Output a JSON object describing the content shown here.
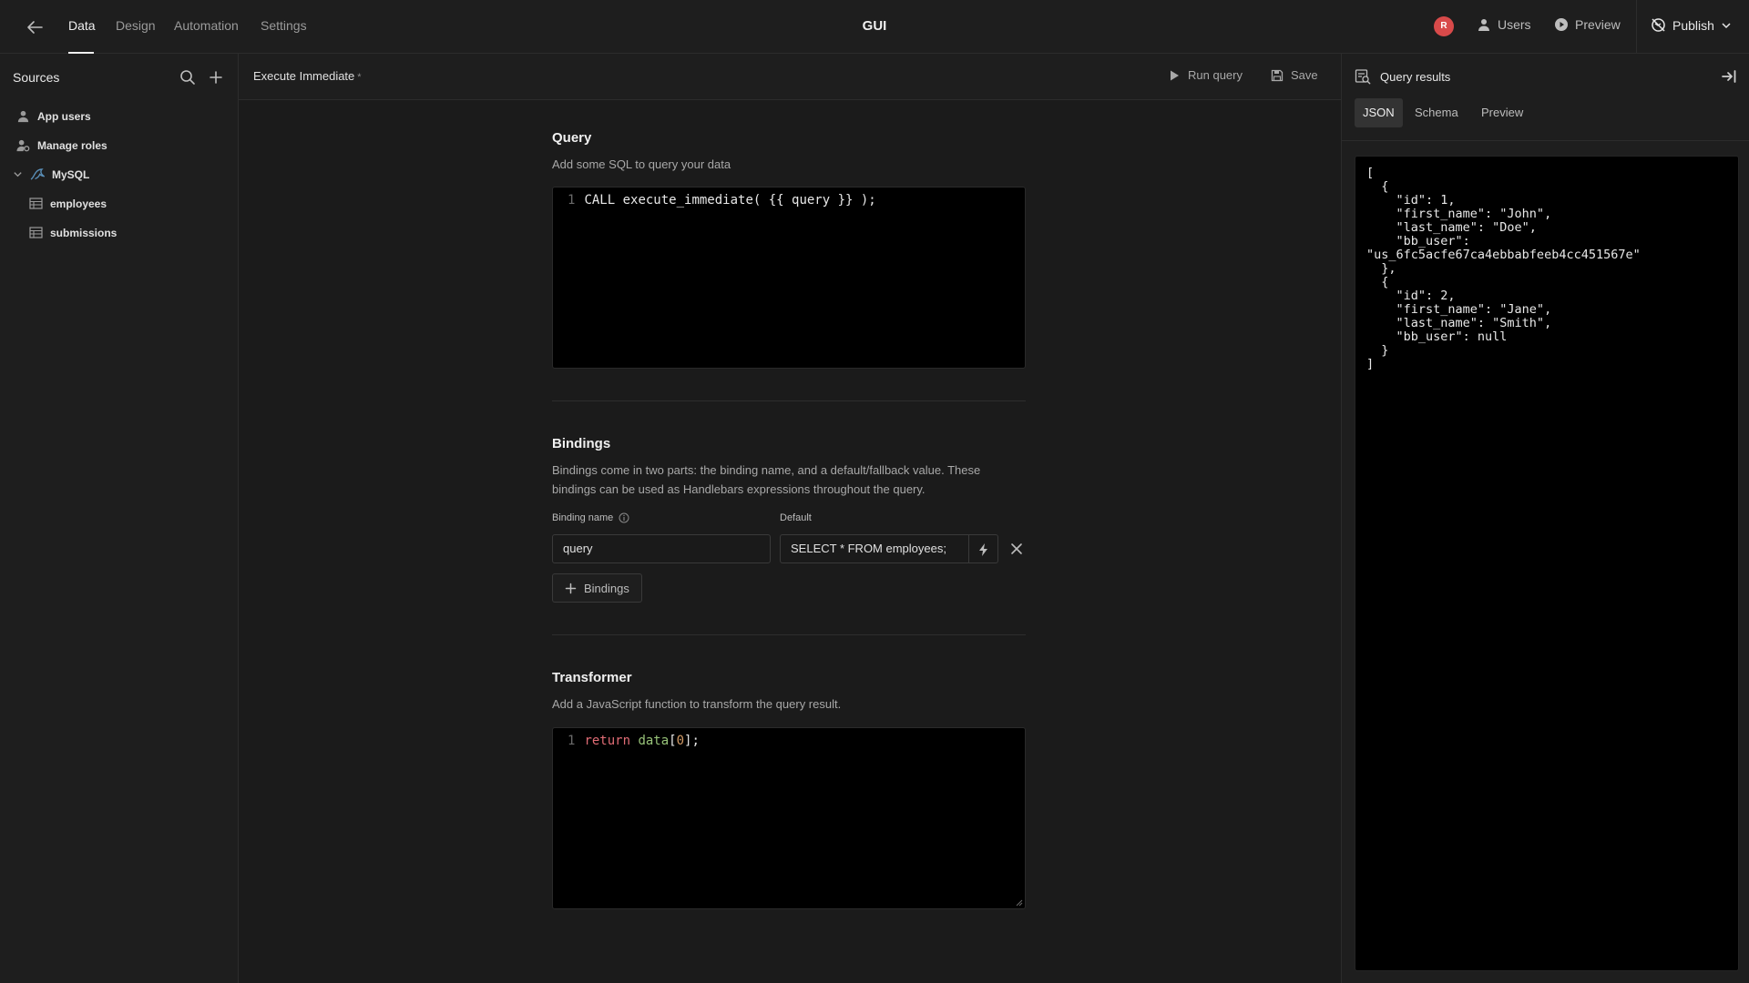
{
  "topbar": {
    "tabs": [
      {
        "label": "Data"
      },
      {
        "label": "Design"
      },
      {
        "label": "Automation"
      },
      {
        "label": "Settings"
      }
    ],
    "app_title": "GUI",
    "avatar_initial": "R",
    "users_label": "Users",
    "preview_label": "Preview",
    "publish_label": "Publish"
  },
  "sidebar": {
    "title": "Sources",
    "items": [
      {
        "label": "App users",
        "icon": "user-icon"
      },
      {
        "label": "Manage roles",
        "icon": "roles-icon"
      },
      {
        "label": "MySQL",
        "icon": "mysql-icon"
      },
      {
        "label": "employees",
        "icon": "table-icon"
      },
      {
        "label": "submissions",
        "icon": "table-icon"
      }
    ]
  },
  "query_editor": {
    "name": "Execute Immediate",
    "dirty_marker": "*",
    "run_label": "Run query",
    "save_label": "Save",
    "query": {
      "title": "Query",
      "description": "Add some SQL to query your data",
      "line_number": "1",
      "code": "CALL execute_immediate( {{ query }} );"
    },
    "bindings": {
      "title": "Bindings",
      "description": "Bindings come in two parts: the binding name, and a default/fallback value. These bindings can be used as Handlebars expressions throughout the query.",
      "name_label": "Binding name",
      "default_label": "Default",
      "binding_name_value": "query",
      "default_value": "SELECT * FROM employees;",
      "add_label": "Bindings"
    },
    "transformer": {
      "title": "Transformer",
      "description": "Add a JavaScript function to transform the query result.",
      "line_number": "1",
      "code_keyword": "return",
      "code_ident": "data",
      "code_open": "[",
      "code_index": "0",
      "code_close": "];"
    }
  },
  "results": {
    "title": "Query results",
    "tabs": [
      {
        "label": "JSON"
      },
      {
        "label": "Schema"
      },
      {
        "label": "Preview"
      }
    ],
    "json_text": "[\n  {\n    \"id\": 1,\n    \"first_name\": \"John\",\n    \"last_name\": \"Doe\",\n    \"bb_user\":\n\"us_6fc5acfe67ca4ebbabfeeb4cc451567e\"\n  },\n  {\n    \"id\": 2,\n    \"first_name\": \"Jane\",\n    \"last_name\": \"Smith\",\n    \"bb_user\": null\n  }\n]"
  },
  "colors": {
    "background": "#1e1e1e",
    "editor_background": "#000000",
    "avatar": "#d84a4a",
    "keyword": "#e06c75",
    "identifier": "#98c379",
    "number": "#d19a66"
  }
}
